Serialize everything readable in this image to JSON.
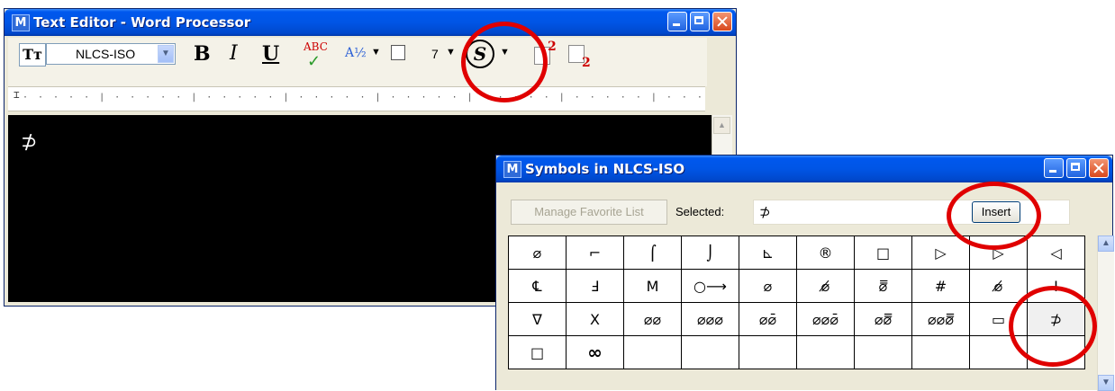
{
  "editor": {
    "title": "Text Editor - Word Processor",
    "app_icon": "M",
    "font_icon": "Tт",
    "font_name": "NLCS-ISO",
    "bold_label": "B",
    "italic_label": "I",
    "underline_label": "U",
    "spell_label": "ABC",
    "fraction_label": "A½",
    "size_value": "7",
    "symbol_label": "S",
    "superscript_label": "2",
    "subscript_label": "2",
    "content": "⊅"
  },
  "symbols": {
    "title": "Symbols in NLCS-ISO",
    "manage_label": "Manage Favorite List",
    "selected_label": "Selected:",
    "selected_value": "⊅",
    "insert_label": "Insert",
    "rows": [
      [
        "⌀",
        "⌐",
        "⌠",
        "⌡",
        "⊾",
        "®",
        "□",
        "▷",
        "▷",
        "◁"
      ],
      [
        "℄",
        "Ⅎ",
        "Ⅿ",
        "○⟶",
        "⌀",
        "⌀̸",
        "⌀̿",
        "#",
        "⌀̸",
        "Ⅰ"
      ],
      [
        "∇",
        "X",
        "⌀⌀",
        "⌀⌀⌀",
        "⌀⌀̄",
        "⌀⌀⌀̄",
        "⌀⌀̿",
        "⌀⌀⌀̿",
        "▭",
        "⊅"
      ],
      [
        "□",
        "∞",
        "",
        "",
        "",
        "",
        "",
        "",
        "",
        ""
      ]
    ]
  }
}
